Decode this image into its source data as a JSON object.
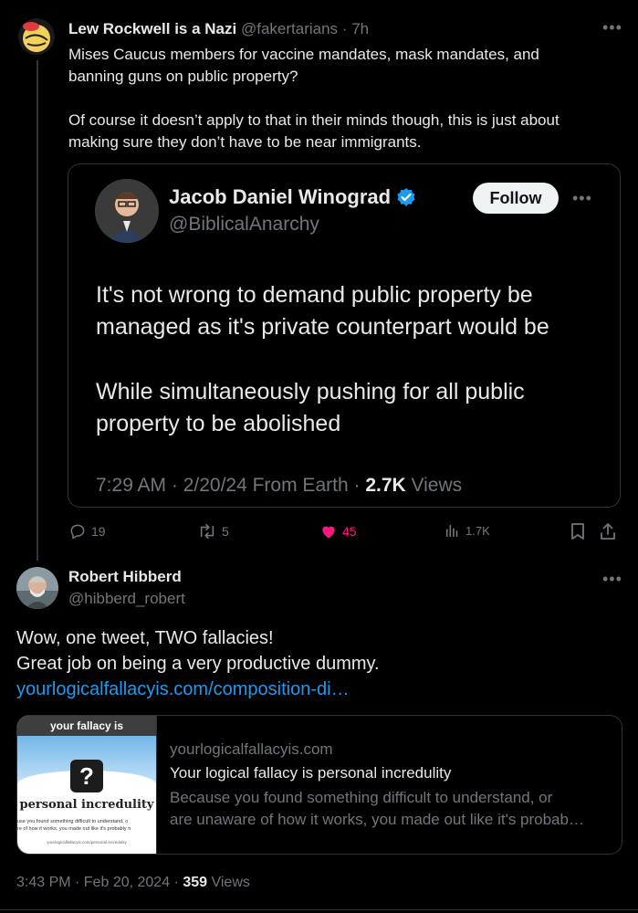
{
  "post1": {
    "display_name": "Lew Rockwell is a Nazi",
    "handle": "@fakertarians",
    "separator": "·",
    "time": "7h",
    "text_line1": "Mises Caucus members for vaccine mandates, mask mandates, and",
    "text_line2": "banning guns on public property?",
    "text_line3": "Of course it doesn’t apply to that in their minds though, this is just about",
    "text_line4": "making sure they don’t have to be near immigrants.",
    "quote": {
      "display_name": "Jacob Daniel Winograd",
      "handle": "@BiblicalAnarchy",
      "follow_label": "Follow",
      "line1": "It's not wrong to demand public property be",
      "line2": "managed as it's private counterpart would be",
      "line3": "While simultaneously pushing for all public",
      "line4": "property to be abolished",
      "timestamp": "7:29 AM · 2/20/24 From Earth ·",
      "views_count": "2.7K",
      "views_label": "Views"
    },
    "actions": {
      "replies": "19",
      "reposts": "5",
      "likes": "45",
      "views": "1.7K"
    }
  },
  "post2": {
    "display_name": "Robert Hibberd",
    "handle": "@hibberd_robert",
    "text_line1": "Wow, one tweet, TWO fallacies!",
    "text_line2": "Great job on being a very productive dummy.",
    "link_text": "yourlogicalfallacyis.com/composition-di…",
    "card": {
      "image_header": "your fallacy is",
      "image_title": "personal incredulity",
      "image_small1": "use you found something difficult to understand, o",
      "image_small2": "re of how it works, you made out like it's probably n",
      "image_footer": "yourlogicalfallacyis.com/personal-incredulity",
      "domain": "yourlogicalfallacyis.com",
      "title": "Your logical fallacy is personal incredulity",
      "desc_line1": "Because you found something difficult to understand, or",
      "desc_line2": "are unaware of how it works, you made out like it's probab…"
    },
    "timestamp": "3:43 PM · Feb 20, 2024 ·",
    "views_count": "359",
    "views_label": "Views"
  },
  "colors": {
    "accent_blue": "#1d9bf0",
    "like_pink": "#f91880",
    "muted": "#71767b",
    "text": "#e7e9ea"
  },
  "icons": [
    "more-icon",
    "verified-icon",
    "reply-icon",
    "repost-icon",
    "heart-icon",
    "views-icon",
    "bookmark-icon",
    "share-icon",
    "question-icon"
  ]
}
